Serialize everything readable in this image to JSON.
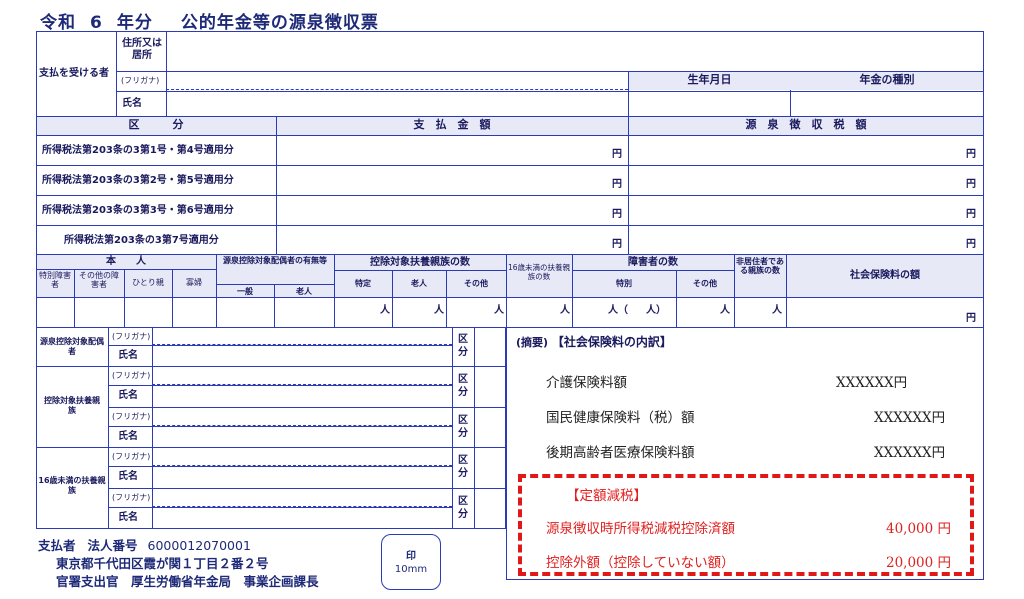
{
  "title": {
    "era": "令和",
    "year": "6",
    "suffix": "年分",
    "name": "公的年金等の源泉徴収票"
  },
  "recipient": {
    "label": "支払を受ける者",
    "address_label": "住所又は居所",
    "furigana_label": "(フリガナ)",
    "name_label": "氏名",
    "birthdate_label": "生年月日",
    "pension_type_label": "年金の種別"
  },
  "payments": {
    "header_category": "区　　　分",
    "header_amount": "支　払　金　額",
    "header_tax": "源　泉　徴　収　税　額",
    "yen": "円",
    "rows": [
      "所得税法第203条の3第1号・第4号適用分",
      "所得税法第203条の3第2号・第5号適用分",
      "所得税法第203条の3第3号・第6号適用分",
      "所得税法第203条の3第7号適用分"
    ]
  },
  "dependents_header": {
    "self": "本　　人",
    "special_disabled": "特別障害者",
    "other_disabled": "その他の障害者",
    "single_parent": "ひとり親",
    "widow": "寡婦",
    "spouse": "源泉控除対象配偶者の有無等",
    "spouse_general": "一般",
    "spouse_elderly": "老人",
    "dependents": "控除対象扶養親族の数",
    "dep_specific": "特定",
    "dep_elderly": "老人",
    "dep_other": "その他",
    "under16": "16歳未満の扶養親族の数",
    "disabled_count": "障害者の数",
    "disabled_special": "特別",
    "disabled_other": "その他",
    "nonresident": "非居住者である親族の数",
    "social_insurance": "社会保険料の額",
    "person_unit": "人",
    "paren_open": "（",
    "paren_close": "人）",
    "yen": "円"
  },
  "family": {
    "spouse_label": "源泉控除対象配偶者",
    "dependents_label": "控除対象扶養親族",
    "under16_label": "16歳未満の扶養親族",
    "furigana": "(フリガナ)",
    "name": "氏名",
    "kubun": "区分"
  },
  "summary": {
    "label": "(摘要)",
    "heading": "【社会保険料の内訳】",
    "items": [
      {
        "label": "介護保険料額",
        "value": "XXXXXX円"
      },
      {
        "label": "国民健康保険料（税）額",
        "value": "XXXXXX円"
      },
      {
        "label": "後期高齢者医療保険料額",
        "value": "XXXXXX円"
      }
    ],
    "flat_heading": "【定額減税】",
    "flat_items": [
      {
        "label": "源泉徴収時所得税減税控除済額",
        "value": "40,000 円"
      },
      {
        "label": "控除外額（控除していない額）",
        "value": "20,000 円"
      }
    ]
  },
  "payer": {
    "label": "支払者",
    "corp_label": "法人番号",
    "corp_number": "6000012070001",
    "address": "東京都千代田区霞が関１丁目２番２号",
    "office": "官署支出官　厚生労働省年金局　事業企画課長",
    "seal_label": "印",
    "seal_size": "10mm"
  },
  "colors": {
    "form_blue": "#2b3bb8",
    "highlight_red": "#e01818"
  }
}
